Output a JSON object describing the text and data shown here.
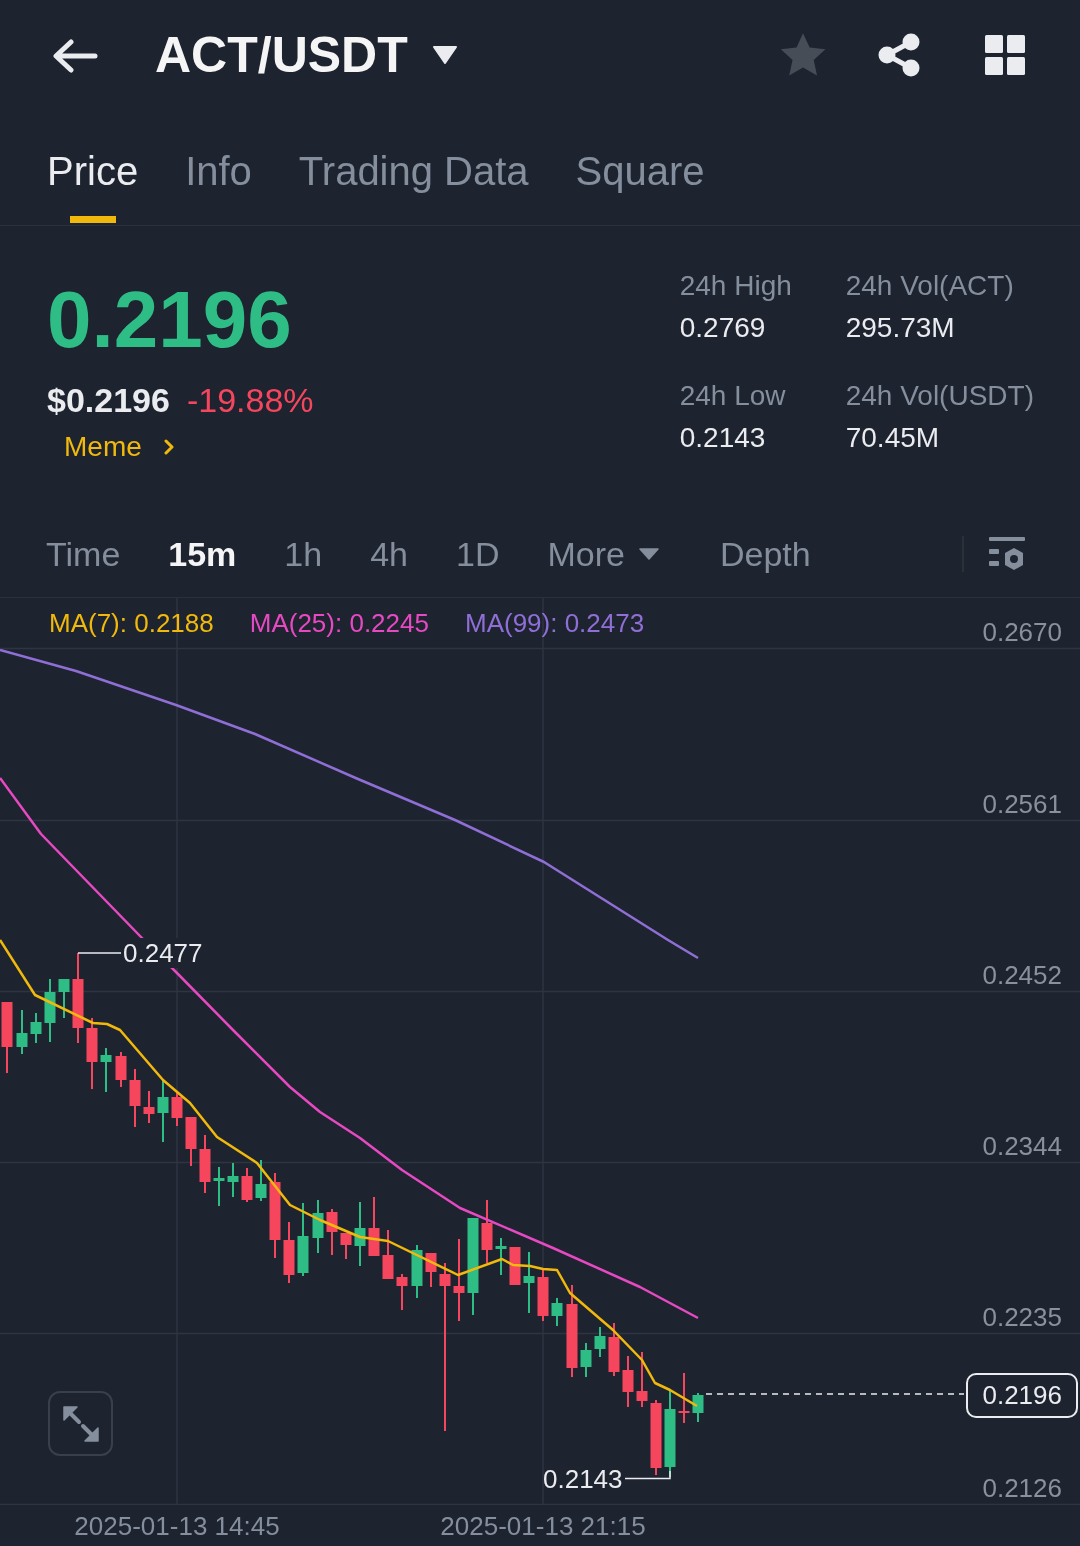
{
  "header": {
    "title": "ACT/USDT",
    "favorited": false
  },
  "tabs": [
    {
      "label": "Price",
      "selected": true
    },
    {
      "label": "Info",
      "selected": false
    },
    {
      "label": "Trading Data",
      "selected": false
    },
    {
      "label": "Square",
      "selected": false
    }
  ],
  "ticker": {
    "price": "0.2196",
    "price_up": true,
    "usd_price": "$0.2196",
    "change": "-19.88%",
    "change_up": false,
    "category": "Meme"
  },
  "stats": [
    {
      "label": "24h High",
      "value": "0.2769"
    },
    {
      "label": "24h Vol(ACT)",
      "value": "295.73M"
    },
    {
      "label": "24h Low",
      "value": "0.2143"
    },
    {
      "label": "24h Vol(USDT)",
      "value": "70.45M"
    }
  ],
  "intervals": [
    {
      "label": "Time",
      "kind": "option",
      "selected": false
    },
    {
      "label": "15m",
      "kind": "option",
      "selected": true
    },
    {
      "label": "1h",
      "kind": "option",
      "selected": false
    },
    {
      "label": "4h",
      "kind": "option",
      "selected": false
    },
    {
      "label": "1D",
      "kind": "option",
      "selected": false
    },
    {
      "label": "More",
      "kind": "dropdown",
      "selected": false
    },
    {
      "label": "Depth",
      "kind": "view",
      "selected": false
    }
  ],
  "chart": {
    "indicators": [
      {
        "label": "MA(7): 0.2188",
        "color": "#f0b90b"
      },
      {
        "label": "MA(25): 0.2245",
        "color": "#e649c2"
      },
      {
        "label": "MA(99): 0.2473",
        "color": "#8f6fd6"
      }
    ],
    "price_axis": [
      "0.2670",
      "0.2561",
      "0.2452",
      "0.2344",
      "0.2235",
      "0.2126"
    ],
    "high_label": "0.2477",
    "low_label": "0.2143",
    "last_price": "0.2196",
    "time_axis": [
      "2025-01-13 14:45",
      "2025-01-13 21:15"
    ]
  }
}
